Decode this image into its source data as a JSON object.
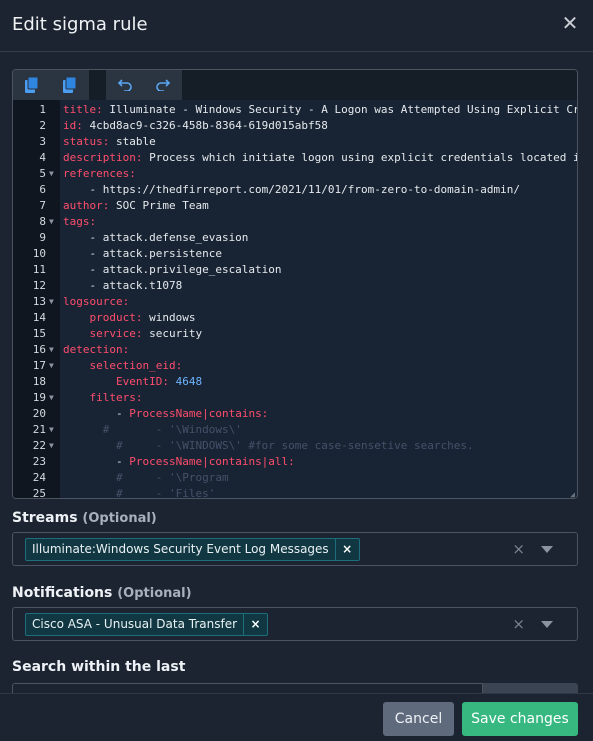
{
  "modal": {
    "title": "Edit sigma rule",
    "close_icon": "close-icon"
  },
  "editor": {
    "toolbar": {
      "buttons": [
        {
          "icon": "copy-icon"
        },
        {
          "icon": "paste-icon"
        },
        {
          "icon": "undo-icon"
        },
        {
          "icon": "redo-icon"
        }
      ]
    },
    "lines": [
      {
        "n": "1",
        "fold": false,
        "segments": [
          {
            "t": "title:",
            "c": "k"
          },
          {
            "t": " Illuminate - Windows Security - A Logon was Attempted Using Explicit Cre",
            "c": ""
          }
        ]
      },
      {
        "n": "2",
        "fold": false,
        "segments": [
          {
            "t": "id:",
            "c": "k"
          },
          {
            "t": " 4cbd8ac9-c326-458b-8364-619d015abf58",
            "c": ""
          }
        ]
      },
      {
        "n": "3",
        "fold": false,
        "segments": [
          {
            "t": "status:",
            "c": "k"
          },
          {
            "t": " stable",
            "c": ""
          }
        ]
      },
      {
        "n": "4",
        "fold": false,
        "segments": [
          {
            "t": "description:",
            "c": "k"
          },
          {
            "t": " Process which initiate logon using explicit credentials located in",
            "c": ""
          }
        ]
      },
      {
        "n": "5",
        "fold": true,
        "segments": [
          {
            "t": "references:",
            "c": "k"
          }
        ]
      },
      {
        "n": "6",
        "fold": false,
        "segments": [
          {
            "t": "    - https://thedfirreport.com/2021/11/01/from-zero-to-domain-admin/",
            "c": ""
          }
        ]
      },
      {
        "n": "7",
        "fold": false,
        "segments": [
          {
            "t": "author:",
            "c": "k"
          },
          {
            "t": " SOC Prime Team",
            "c": ""
          }
        ]
      },
      {
        "n": "8",
        "fold": true,
        "segments": [
          {
            "t": "tags:",
            "c": "k"
          }
        ]
      },
      {
        "n": "9",
        "fold": false,
        "segments": [
          {
            "t": "    - attack.defense_evasion",
            "c": ""
          }
        ]
      },
      {
        "n": "10",
        "fold": false,
        "segments": [
          {
            "t": "    - attack.persistence",
            "c": ""
          }
        ]
      },
      {
        "n": "11",
        "fold": false,
        "segments": [
          {
            "t": "    - attack.privilege_escalation",
            "c": ""
          }
        ]
      },
      {
        "n": "12",
        "fold": false,
        "segments": [
          {
            "t": "    - attack.t1078",
            "c": ""
          }
        ]
      },
      {
        "n": "13",
        "fold": true,
        "segments": [
          {
            "t": "logsource:",
            "c": "k"
          }
        ]
      },
      {
        "n": "14",
        "fold": false,
        "segments": [
          {
            "t": "    ",
            "c": ""
          },
          {
            "t": "product:",
            "c": "k"
          },
          {
            "t": " windows",
            "c": ""
          }
        ]
      },
      {
        "n": "15",
        "fold": false,
        "segments": [
          {
            "t": "    ",
            "c": ""
          },
          {
            "t": "service:",
            "c": "k"
          },
          {
            "t": " security",
            "c": ""
          }
        ]
      },
      {
        "n": "16",
        "fold": true,
        "segments": [
          {
            "t": "detection:",
            "c": "k"
          }
        ]
      },
      {
        "n": "17",
        "fold": true,
        "segments": [
          {
            "t": "    ",
            "c": ""
          },
          {
            "t": "selection_eid:",
            "c": "k"
          }
        ]
      },
      {
        "n": "18",
        "fold": false,
        "segments": [
          {
            "t": "        ",
            "c": ""
          },
          {
            "t": "EventID:",
            "c": "k"
          },
          {
            "t": " 4648",
            "c": "num"
          }
        ]
      },
      {
        "n": "19",
        "fold": true,
        "segments": [
          {
            "t": "    ",
            "c": ""
          },
          {
            "t": "filters:",
            "c": "k"
          }
        ]
      },
      {
        "n": "20",
        "fold": false,
        "segments": [
          {
            "t": "        - ",
            "c": ""
          },
          {
            "t": "ProcessName|contains:",
            "c": "k"
          }
        ]
      },
      {
        "n": "21",
        "fold": true,
        "segments": [
          {
            "t": "      #       - '\\Windows\\'",
            "c": "cm"
          }
        ]
      },
      {
        "n": "22",
        "fold": true,
        "segments": [
          {
            "t": "        #     - '\\WINDOWS\\' #for some case-sensetive searches.",
            "c": "cm"
          }
        ]
      },
      {
        "n": "23",
        "fold": false,
        "segments": [
          {
            "t": "        - ",
            "c": ""
          },
          {
            "t": "ProcessName|contains|all:",
            "c": "k"
          }
        ]
      },
      {
        "n": "24",
        "fold": false,
        "segments": [
          {
            "t": "        #     - '\\Program",
            "c": "cm"
          }
        ]
      },
      {
        "n": "25",
        "fold": false,
        "segments": [
          {
            "t": "        #     - 'Files'",
            "c": "cm"
          }
        ]
      }
    ]
  },
  "streams": {
    "label": "Streams",
    "optional": "(Optional)",
    "chip": "Illuminate:Windows Security Event Log Messages",
    "chip_remove": "×",
    "clear": "×"
  },
  "notifications": {
    "label": "Notifications",
    "optional": "(Optional)",
    "chip": "Cisco ASA - Unusual Data Transfer",
    "chip_remove": "×",
    "clear": "×"
  },
  "search": {
    "label": "Search within the last"
  },
  "footer": {
    "cancel_label": "Cancel",
    "save_label": "Save changes"
  }
}
